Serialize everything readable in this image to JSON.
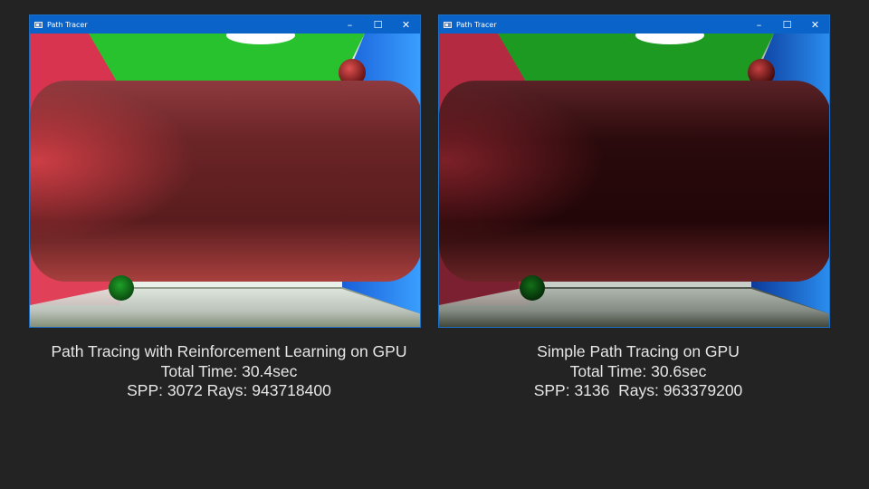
{
  "windows": [
    {
      "title": "Path Tracer",
      "controls": {
        "minimize": "–",
        "maximize": "☐",
        "close": "✕"
      },
      "caption": {
        "line1": "Path Tracing with Reinforcement Learning on GPU",
        "line2": "Total Time: 30.4sec",
        "line3": "SPP: 3072 Rays: 943718400"
      }
    },
    {
      "title": "Path Tracer",
      "controls": {
        "minimize": "–",
        "maximize": "☐",
        "close": "✕"
      },
      "caption": {
        "line1": "Simple Path Tracing on GPU",
        "line2": "Total Time: 30.6sec",
        "line3": "SPP: 3136  Rays: 963379200"
      }
    }
  ],
  "colors": {
    "background": "#232323",
    "titlebar": "#0a63c9",
    "caption_text": "#e6e6e6",
    "wall_left": "#d8344f",
    "wall_right": "#2a8ff0",
    "ceiling": "#27c22d",
    "floor": "#c6ccc6"
  }
}
